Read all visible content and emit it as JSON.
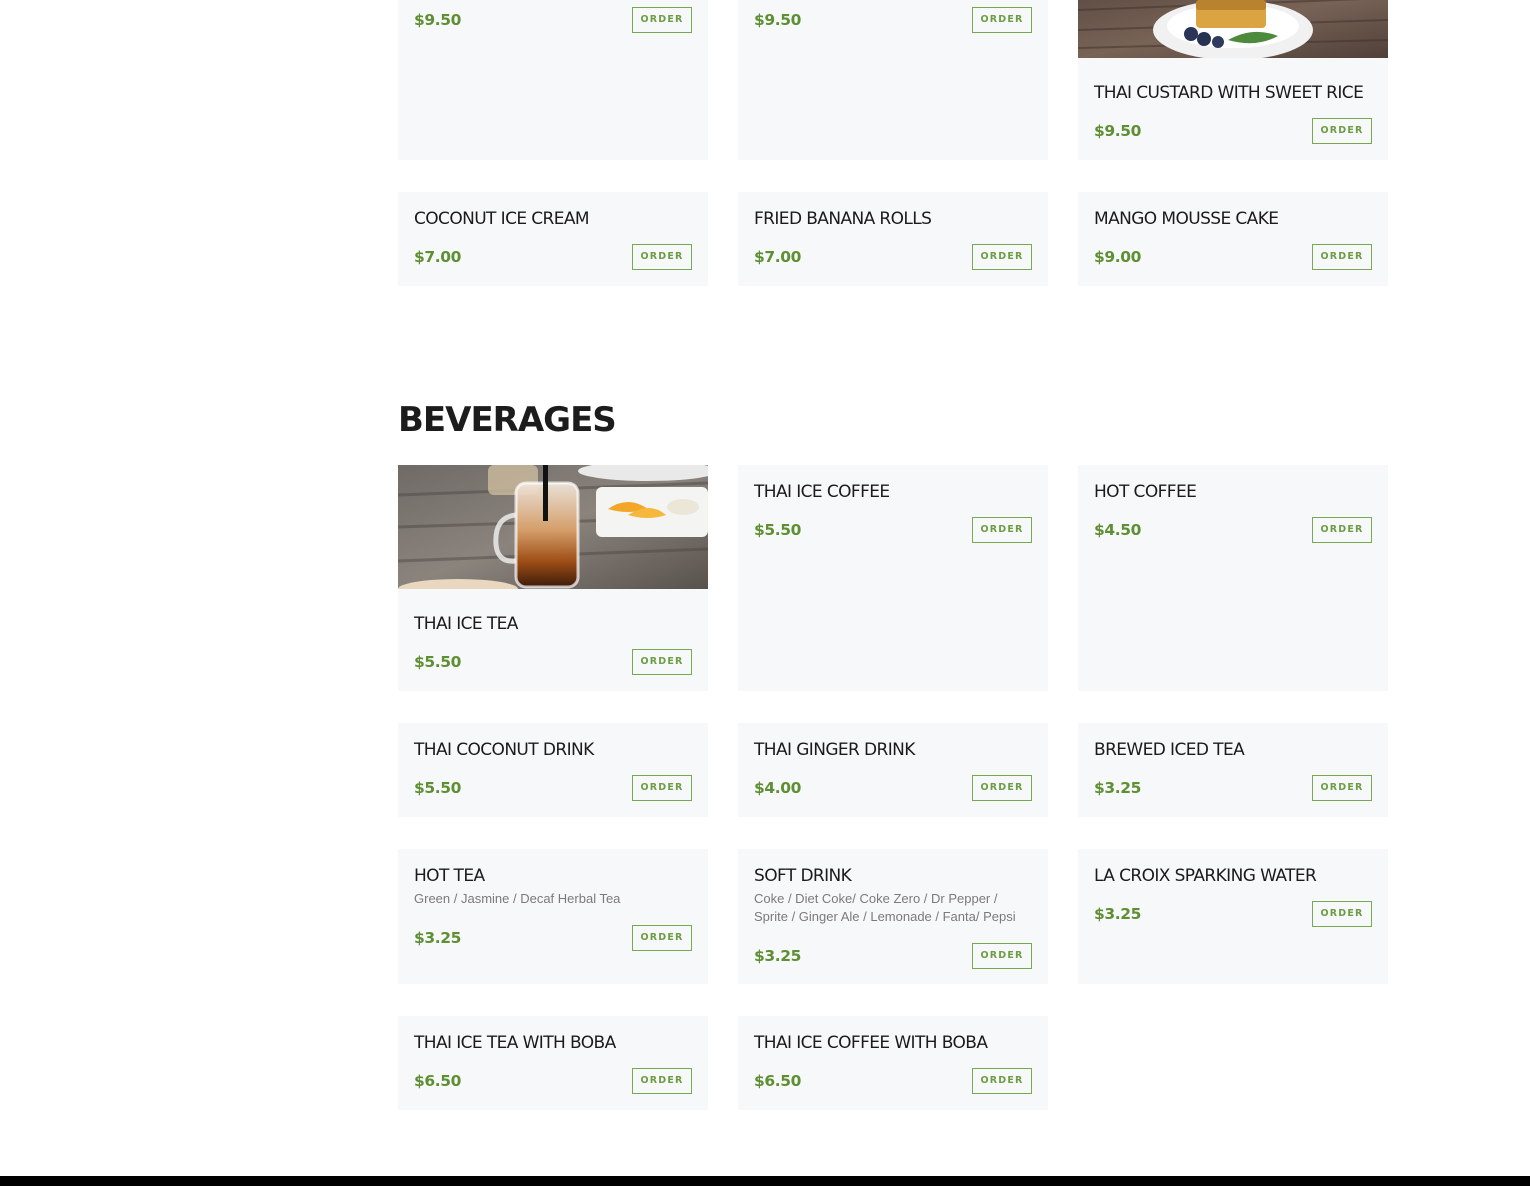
{
  "desserts": {
    "items": [
      {
        "price": "$9.50",
        "order_label": "ORDER"
      },
      {
        "price": "$9.50",
        "order_label": "ORDER"
      },
      {
        "name": "THAI CUSTARD WITH SWEET RICE",
        "price": "$9.50",
        "order_label": "ORDER",
        "image": "thai-custard-photo"
      },
      {
        "name": "COCONUT ICE CREAM",
        "price": "$7.00",
        "order_label": "ORDER"
      },
      {
        "name": "FRIED BANANA ROLLS",
        "price": "$7.00",
        "order_label": "ORDER"
      },
      {
        "name": "MANGO MOUSSE CAKE",
        "price": "$9.00",
        "order_label": "ORDER"
      }
    ]
  },
  "beverages": {
    "title": "BEVERAGES",
    "items": [
      {
        "name": "THAI ICE TEA",
        "price": "$5.50",
        "order_label": "ORDER",
        "image": "thai-ice-tea-photo"
      },
      {
        "name": "THAI ICE COFFEE",
        "price": "$5.50",
        "order_label": "ORDER"
      },
      {
        "name": "HOT COFFEE",
        "price": "$4.50",
        "order_label": "ORDER"
      },
      {
        "name": "THAI COCONUT DRINK",
        "price": "$5.50",
        "order_label": "ORDER"
      },
      {
        "name": "THAI GINGER DRINK",
        "price": "$4.00",
        "order_label": "ORDER"
      },
      {
        "name": "BREWED ICED TEA",
        "price": "$3.25",
        "order_label": "ORDER"
      },
      {
        "name": "HOT TEA",
        "description": "Green / Jasmine / Decaf Herbal Tea",
        "price": "$3.25",
        "order_label": "ORDER"
      },
      {
        "name": "SOFT DRINK",
        "description": "Coke / Diet Coke/ Coke Zero / Dr Pepper / Sprite / Ginger Ale / Lemonade / Fanta/ Pepsi",
        "price": "$3.25",
        "order_label": "ORDER"
      },
      {
        "name": "LA CROIX SPARKING WATER",
        "price": "$3.25",
        "order_label": "ORDER"
      },
      {
        "name": "THAI ICE TEA WITH BOBA",
        "price": "$6.50",
        "order_label": "ORDER"
      },
      {
        "name": "THAI ICE COFFEE WITH BOBA",
        "price": "$6.50",
        "order_label": "ORDER"
      }
    ]
  },
  "colors": {
    "accent_green": "#5e8f33",
    "card_background": "#f7f8f9",
    "footer": "#000000"
  }
}
